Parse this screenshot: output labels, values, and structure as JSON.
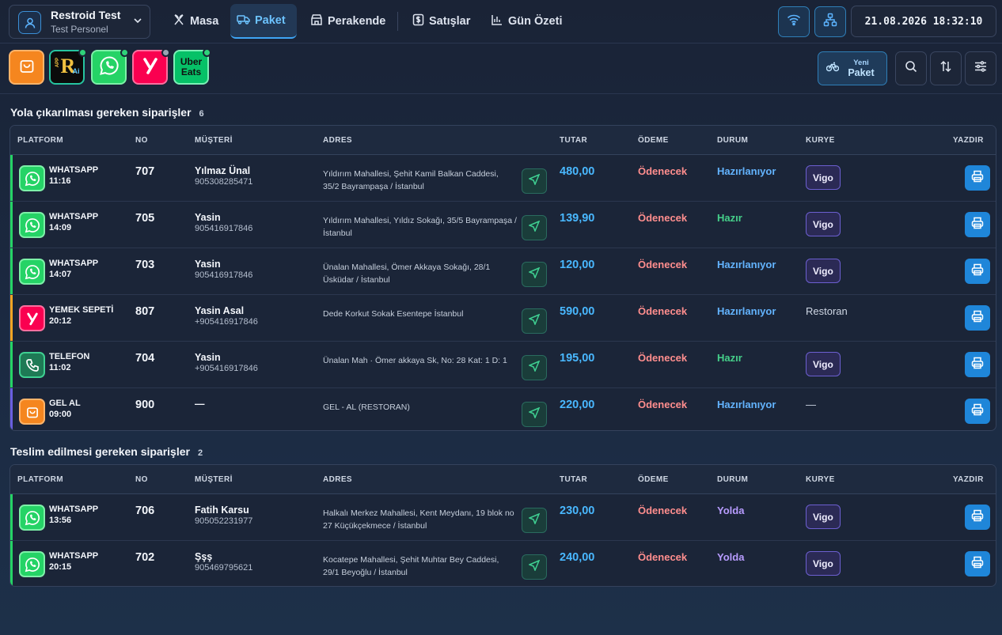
{
  "account": {
    "name": "Restroid Test",
    "role": "Test Personel"
  },
  "nav": {
    "masa": "Masa",
    "paket": "Paket",
    "perakende": "Perakende",
    "satislar": "Satışlar",
    "gun_ozeti": "Gün Özeti"
  },
  "clock": "21.08.2026 18:32:10",
  "platforms": {
    "uber_line1": "Uber",
    "uber_line2": "Eats",
    "appr_small": "APP",
    "appr_letter": "R",
    "appr_ai": "Ai"
  },
  "new_package": {
    "line1": "Yeni",
    "line2": "Paket"
  },
  "columns": {
    "platform": "PLATFORM",
    "no": "NO",
    "customer": "MÜŞTERİ",
    "address": "ADRES",
    "amount": "TUTAR",
    "payment": "ÖDEME",
    "status": "DURUM",
    "courier": "KURYE",
    "print": "YAZDIR"
  },
  "sections": [
    {
      "title": "Yola çıkarılması gereken siparişler",
      "count": "6",
      "orders": [
        {
          "platform": "WHATSAPP",
          "icon": "whatsapp-icon",
          "time": "11:16",
          "no": "707",
          "customer": "Yılmaz Ünal",
          "phone": "905308285471",
          "address": "Yıldırım Mahallesi, Şehit Kamil Balkan Caddesi, 35/2 Bayrampaşa / İstanbul",
          "amount": "480,00",
          "payment": "Ödenecek",
          "status": "Hazırlanıyor",
          "status_key": "hazirlaniyor",
          "courier": "Vigo",
          "courier_badge": true
        },
        {
          "platform": "WHATSAPP",
          "icon": "whatsapp-icon",
          "time": "14:09",
          "no": "705",
          "customer": "Yasin",
          "phone": "905416917846",
          "address": "Yıldırım Mahallesi, Yıldız Sokağı, 35/5 Bayrampaşa / İstanbul",
          "amount": "139,90",
          "payment": "Ödenecek",
          "status": "Hazır",
          "status_key": "hazir",
          "courier": "Vigo",
          "courier_badge": true
        },
        {
          "platform": "WHATSAPP",
          "icon": "whatsapp-icon",
          "time": "14:07",
          "no": "703",
          "customer": "Yasin",
          "phone": "905416917846",
          "address": "Ünalan Mahallesi, Ömer Akkaya Sokağı, 28/1 Üsküdar / İstanbul",
          "amount": "120,00",
          "payment": "Ödenecek",
          "status": "Hazırlanıyor",
          "status_key": "hazirlaniyor",
          "courier": "Vigo",
          "courier_badge": true
        },
        {
          "platform": "YEMEK SEPETİ",
          "icon": "yemeksepeti-icon",
          "time": "20:12",
          "no": "807",
          "customer": "Yasin Asal",
          "phone": "+905416917846",
          "address": "Dede Korkut Sokak Esentepe İstanbul",
          "amount": "590,00",
          "payment": "Ödenecek",
          "status": "Hazırlanıyor",
          "status_key": "hazirlaniyor",
          "courier": "Restoran",
          "courier_badge": false
        },
        {
          "platform": "TELEFON",
          "icon": "phone-icon",
          "time": "11:02",
          "no": "704",
          "customer": "Yasin",
          "phone": "+905416917846",
          "address": "Ünalan Mah · Ömer akkaya Sk, No: 28 Kat: 1 D: 1",
          "amount": "195,00",
          "payment": "Ödenecek",
          "status": "Hazır",
          "status_key": "hazir",
          "courier": "Vigo",
          "courier_badge": true
        },
        {
          "platform": "GEL AL",
          "icon": "shopping-bag-icon",
          "time": "09:00",
          "no": "900",
          "customer": "—",
          "phone": "",
          "address": "GEL - AL (RESTORAN)",
          "amount": "220,00",
          "payment": "Ödenecek",
          "status": "Hazırlanıyor",
          "status_key": "hazirlaniyor",
          "courier": "—",
          "courier_badge": false
        }
      ]
    },
    {
      "title": "Teslim edilmesi gereken siparişler",
      "count": "2",
      "orders": [
        {
          "platform": "WHATSAPP",
          "icon": "whatsapp-icon",
          "time": "13:56",
          "no": "706",
          "customer": "Fatih Karsu",
          "phone": "905052231977",
          "address": "Halkalı Merkez Mahallesi, Kent Meydanı, 19 blok no 27 Küçükçekmece / İstanbul",
          "amount": "230,00",
          "payment": "Ödenecek",
          "status": "Yolda",
          "status_key": "yolda",
          "courier": "Vigo",
          "courier_badge": true
        },
        {
          "platform": "WHATSAPP",
          "icon": "whatsapp-icon",
          "time": "20:15",
          "no": "702",
          "customer": "Şşş",
          "phone": "905469795621",
          "address": "Kocatepe Mahallesi, Şehit Muhtar Bey Caddesi, 29/1 Beyoğlu / İstanbul",
          "amount": "240,00",
          "payment": "Ödenecek",
          "status": "Yolda",
          "status_key": "yolda",
          "courier": "Vigo",
          "courier_badge": true
        }
      ]
    }
  ],
  "colors": {
    "accent": "#3ea5f5",
    "whatsapp": "#25d366",
    "yemeksepeti": "#fa0050",
    "getir_orange": "#f5861f",
    "uber_green": "#06c167",
    "amount": "#49b8ff",
    "payment_due": "#ff8e8e"
  }
}
